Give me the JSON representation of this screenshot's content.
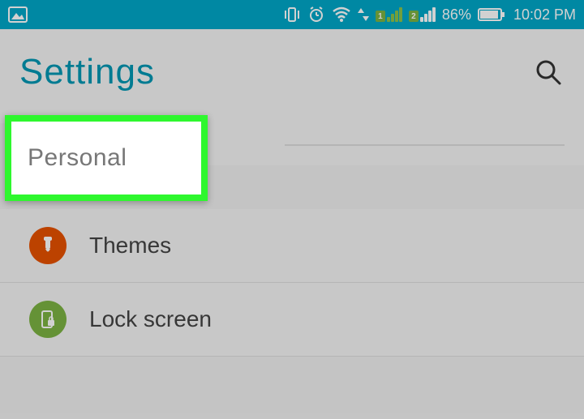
{
  "status_bar": {
    "battery_pct": "86%",
    "time": "10:02 PM",
    "sim1": "1",
    "sim2": "2"
  },
  "header": {
    "title": "Settings"
  },
  "section": {
    "label": "Personal"
  },
  "items": [
    {
      "label": "Themes"
    },
    {
      "label": "Lock screen"
    }
  ]
}
